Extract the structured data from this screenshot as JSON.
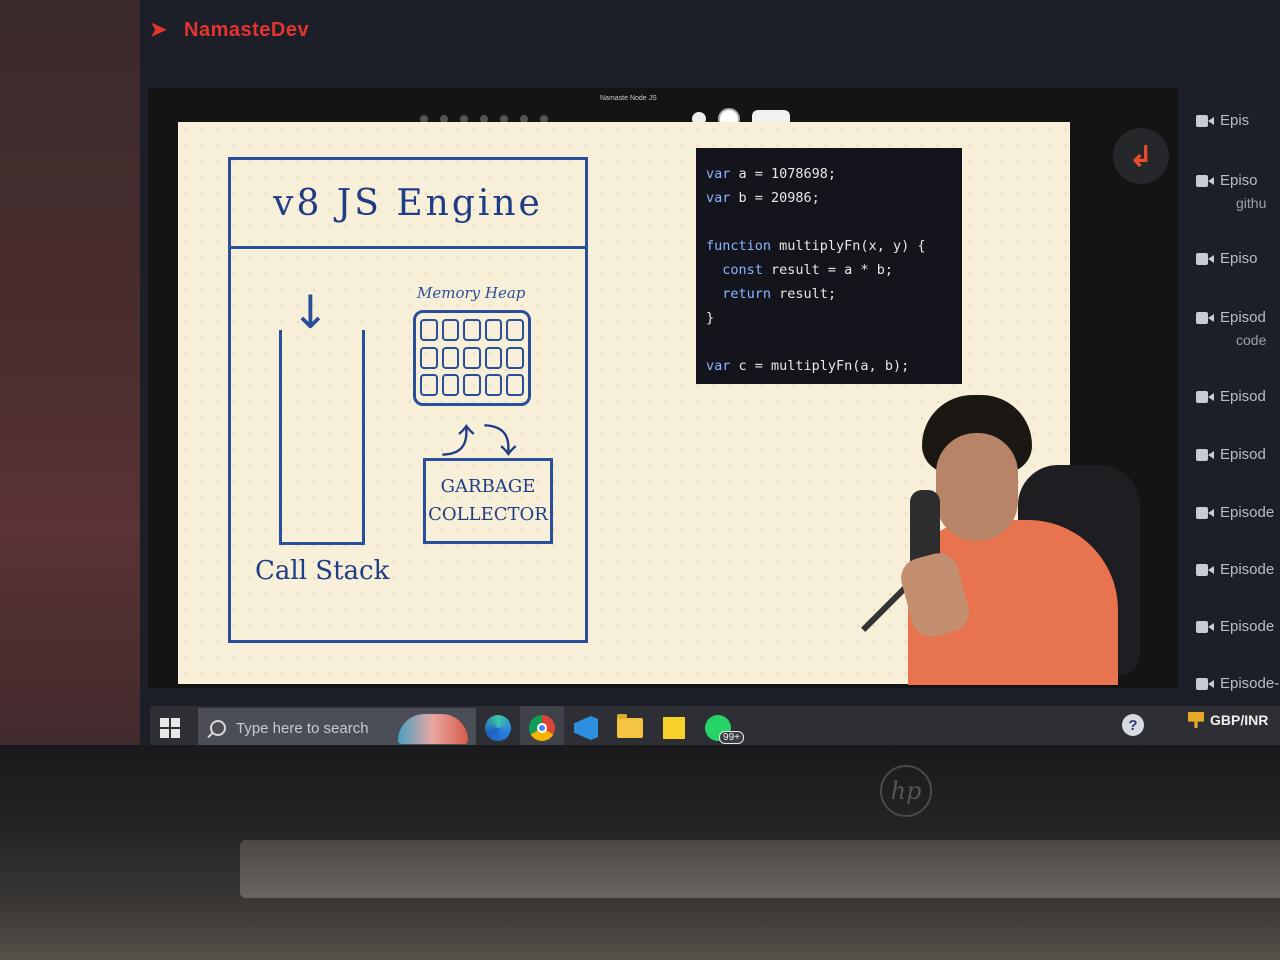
{
  "brand": {
    "name": "NamasteDev",
    "accent": "#e3342f"
  },
  "video": {
    "title": "Namaste Node JS",
    "whiteboard": {
      "engine_title": "v8 JS Engine",
      "call_stack_label": "Call Stack",
      "memory_heap_label": "Memory Heap",
      "gc_label_line1": "GARBAGE",
      "gc_label_line2": "COLLECTOR",
      "ink_color": "#2a4f9a"
    },
    "code": {
      "line1_kw": "var",
      "line1_rest": " a = 1078698;",
      "line2_kw": "var",
      "line2_rest": " b = 20986;",
      "line3_kw": "function",
      "line3_rest": " multiplyFn(x, y) {",
      "line4_kw": "const",
      "line4_rest": " result = a * b;",
      "line5_kw": "return",
      "line5_rest": " result;",
      "line6": "}",
      "line7_kw": "var",
      "line7_rest": " c = multiplyFn(a, b);"
    }
  },
  "sidebar": {
    "record_icon": "record-icon",
    "episodes": [
      {
        "label": "Epis",
        "sub": ""
      },
      {
        "label": "Episo",
        "sub": "githu"
      },
      {
        "label": "Episo",
        "sub": ""
      },
      {
        "label": "Episod",
        "sub": "code"
      },
      {
        "label": "Episod",
        "sub": ""
      },
      {
        "label": "Episod",
        "sub": ""
      },
      {
        "label": "Episode",
        "sub": ""
      },
      {
        "label": "Episode",
        "sub": ""
      },
      {
        "label": "Episode",
        "sub": ""
      },
      {
        "label": "Episode-",
        "sub": ""
      }
    ]
  },
  "taskbar": {
    "search_placeholder": "Type here to search",
    "apps": [
      "edge-icon",
      "chrome-icon",
      "vscode-icon",
      "file-explorer-icon",
      "sticky-notes-icon",
      "whatsapp-icon"
    ],
    "whatsapp_badge": "99+",
    "widget_label": "GBP/INR"
  },
  "device": {
    "logo": "hp"
  }
}
